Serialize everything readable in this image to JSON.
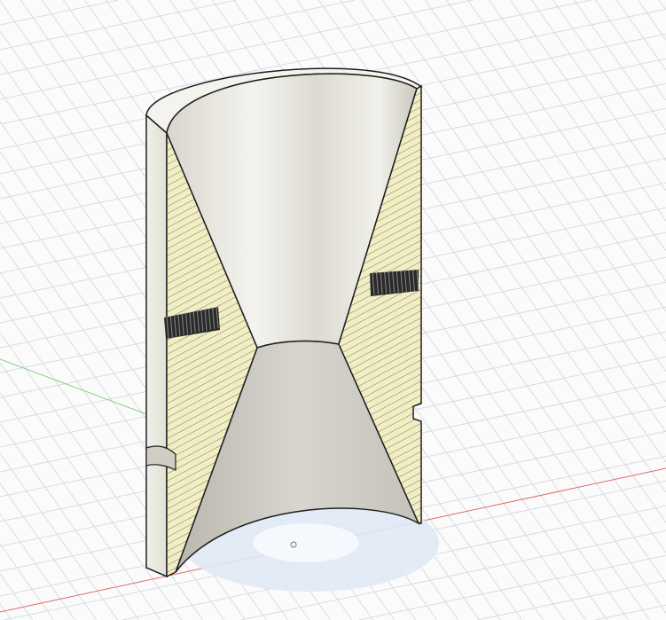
{
  "viewport": {
    "colors": {
      "background": "#fbfbfb",
      "grid": "#d9dcdf",
      "x_axis": "#e06a6a",
      "y_axis": "#7fcf7f",
      "section_fill": "#f2eec4",
      "hatch": "#6b6a55",
      "body": "#ecebe4",
      "edge": "#1e1e1e",
      "shadow": "#dfe9f5"
    }
  }
}
